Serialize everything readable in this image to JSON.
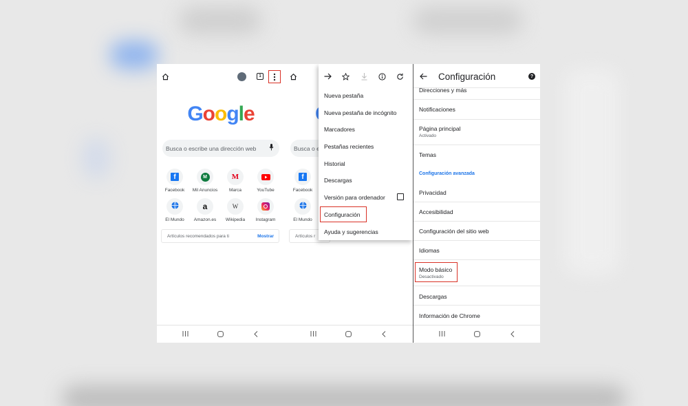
{
  "panel1": {
    "logo": "Google",
    "search_placeholder": "Busca o escribe una dirección web",
    "tiles": [
      {
        "label": "Facebook",
        "icon": "facebook-icon"
      },
      {
        "label": "Mil Anuncios",
        "icon": "milanuncios-icon"
      },
      {
        "label": "Marca",
        "icon": "marca-icon"
      },
      {
        "label": "YouTube",
        "icon": "youtube-icon"
      },
      {
        "label": "El Mundo",
        "icon": "globe-icon"
      },
      {
        "label": "Amazon.es",
        "icon": "amazon-icon"
      },
      {
        "label": "Wikipedia",
        "icon": "wikipedia-icon"
      },
      {
        "label": "Instagram",
        "icon": "instagram-icon"
      }
    ],
    "articles_label": "Artículos recomendados para ti",
    "articles_action": "Mostrar"
  },
  "panel2": {
    "search_placeholder_partial": "Busca o e",
    "tiles": [
      {
        "label": "Facebook"
      },
      {
        "label": "El Mundo"
      }
    ],
    "articles_partial": "Artículos r",
    "menu_items": [
      "Nueva pestaña",
      "Nueva pestaña de incógnito",
      "Marcadores",
      "Pestañas recientes",
      "Historial",
      "Descargas",
      "Versión para ordenador",
      "Configuración",
      "Ayuda y sugerencias"
    ]
  },
  "panel3": {
    "title": "Configuración",
    "items": {
      "direcciones": "Direcciones y más",
      "notificaciones": "Notificaciones",
      "pagina_principal": "Página principal",
      "pagina_principal_sub": "Activado",
      "temas": "Temas",
      "section_advanced": "Configuración avanzada",
      "privacidad": "Privacidad",
      "accesibilidad": "Accesibilidad",
      "sitio_web": "Configuración del sitio web",
      "idiomas": "Idiomas",
      "modo_basico": "Modo básico",
      "modo_basico_sub": "Desactivado",
      "descargas": "Descargas",
      "info_chrome": "Información de Chrome"
    }
  },
  "colors": {
    "highlight": "#d93025",
    "link_blue": "#1a73e8",
    "google_blue": "#4285f4",
    "google_red": "#ea4335",
    "google_yellow": "#fbbc05",
    "google_green": "#34a853"
  }
}
